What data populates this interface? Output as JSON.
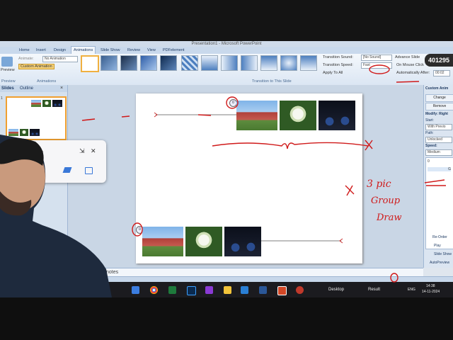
{
  "window": {
    "title": "Presentation1 - Microsoft PowerPoint"
  },
  "tabs": [
    "Home",
    "Insert",
    "Design",
    "Animations",
    "Slide Show",
    "Review",
    "View",
    "PDFelement"
  ],
  "ribbon": {
    "preview_label": "Preview",
    "animate_label": "Animate:",
    "animate_value": "No Animation",
    "custom_animation_label": "Custom Animation",
    "animations_group": "Animations",
    "preview_group": "Preview",
    "transition_group": "Transition to This Slide",
    "transition_sound_label": "Transition Sound:",
    "transition_sound_value": "[No Sound]",
    "transition_speed_label": "Transition Speed:",
    "transition_speed_value": "Fast",
    "apply_to_all_label": "Apply To All",
    "advance_slide_label": "Advance Slide",
    "on_mouse_click_label": "On Mouse Click",
    "auto_after_label": "Automatically After:",
    "auto_after_value": "00:02"
  },
  "left_pane": {
    "tabs": [
      "Slides",
      "Outline"
    ],
    "close": "×",
    "slide_number": "1"
  },
  "slide": {
    "top_anim_badge": "0",
    "bottom_anim_badge": "0"
  },
  "right_pane": {
    "header": "Custom Anim",
    "change_label": "Change",
    "remove_label": "Remove",
    "modify_label": "Modify: Right",
    "start_label": "Start:",
    "start_value": "With Previo",
    "path_label": "Path:",
    "path_value": "Unlocked",
    "speed_label": "Speed:",
    "speed_value": "Medium",
    "item1": "0",
    "item2": "G",
    "reorder_label": "Re-Order",
    "play_label": "Play",
    "slideshow_label": "Slide Show",
    "autopreview_label": "AutoPreview"
  },
  "notes": {
    "placeholder": "notes"
  },
  "popup": {
    "title": "ote",
    "shrink": "⇲",
    "close": "✕"
  },
  "taskbar": {
    "desktop_label": "Desktop",
    "result_label": "Result",
    "lang": "ENG",
    "time": "14:38",
    "date": "14-11-2024"
  },
  "annotation": {
    "text_lines": [
      "3 pic",
      "Group",
      "Draw"
    ]
  },
  "watermark": "401295",
  "colors": {
    "ink": "#d01a1a",
    "accent": "#f0a030",
    "ribbon": "#dbe6f3"
  }
}
